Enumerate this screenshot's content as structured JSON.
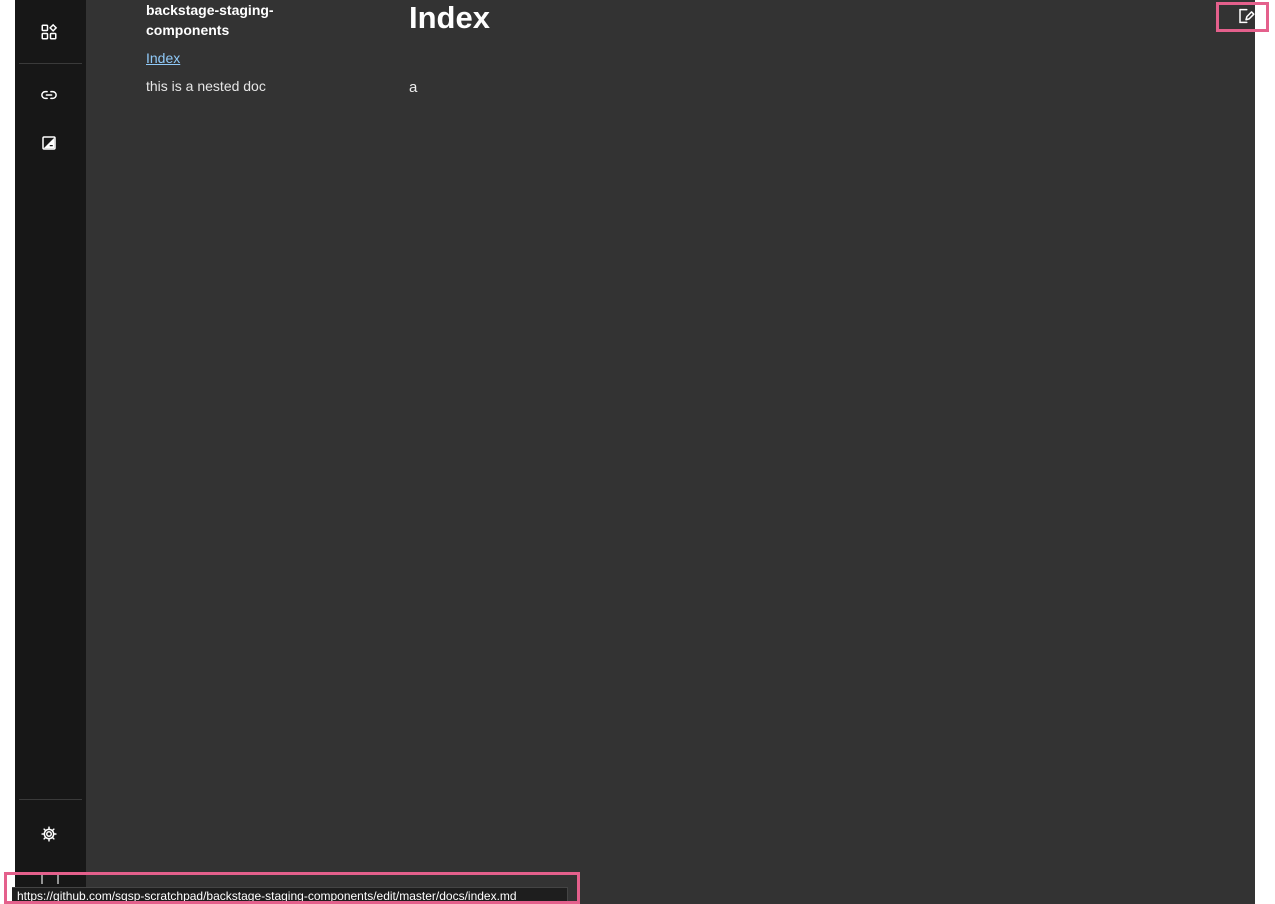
{
  "sidebar": {
    "icons": [
      "grid-icon",
      "link-icon",
      "contrast-icon",
      "gear-icon"
    ]
  },
  "docs_nav": {
    "repo_title": "backstage-staging-components",
    "link_label": "Index",
    "nested_text": "this is a nested doc"
  },
  "content": {
    "title": "Index",
    "body": "a"
  },
  "toolbar": {
    "edit_icon": "edit-doc-icon"
  },
  "status_bar": {
    "url": "https://github.com/sqsp-scratchpad/backstage-staging-components/edit/master/docs/index.md"
  },
  "colors": {
    "page_background": "#333333",
    "rail_background": "#171717",
    "link": "#90caf9",
    "highlight": "#e4608c"
  }
}
